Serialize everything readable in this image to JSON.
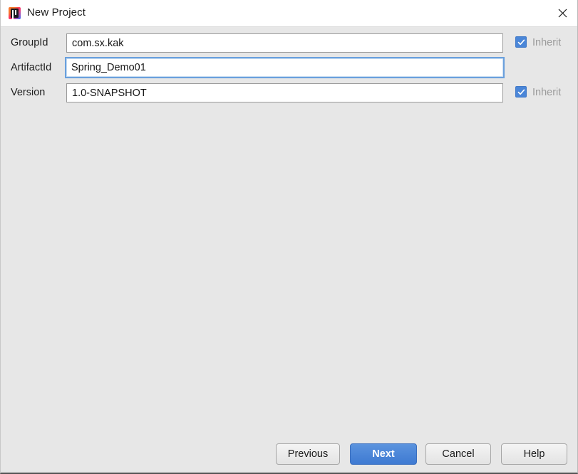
{
  "window": {
    "title": "New Project",
    "app_icon": "intellij-idea-icon",
    "close_icon": "close-icon",
    "background_color": "#e7e7e7",
    "titlebar_color": "#ffffff"
  },
  "form": {
    "fields": [
      {
        "label": "GroupId",
        "value": "com.sx.kak",
        "focused": false,
        "inherit": {
          "label": "Inherit",
          "checked": true,
          "disabled": true
        }
      },
      {
        "label": "ArtifactId",
        "value": "Spring_Demo01",
        "focused": true,
        "inherit": null
      },
      {
        "label": "Version",
        "value": "1.0-SNAPSHOT",
        "focused": false,
        "inherit": {
          "label": "Inherit",
          "checked": true,
          "disabled": true
        }
      }
    ]
  },
  "footer": {
    "previous_label": "Previous",
    "next_label": "Next",
    "cancel_label": "Cancel",
    "help_label": "Help",
    "primary_color": "#4a86d8"
  }
}
